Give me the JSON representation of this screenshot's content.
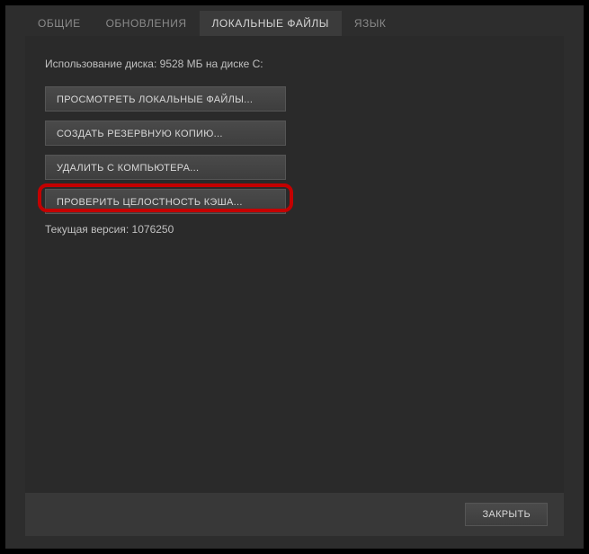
{
  "tabs": {
    "general": "ОБЩИЕ",
    "updates": "ОБНОВЛЕНИЯ",
    "local_files": "ЛОКАЛЬНЫЕ ФАЙЛЫ",
    "language": "ЯЗЫК"
  },
  "content": {
    "disk_usage": "Использование диска: 9528 МБ на диске C:",
    "browse_local": "ПРОСМОТРЕТЬ ЛОКАЛЬНЫЕ ФАЙЛЫ...",
    "backup": "СОЗДАТЬ РЕЗЕРВНУЮ КОПИЮ...",
    "delete": "УДАЛИТЬ С КОМПЬЮТЕРА...",
    "verify": "ПРОВЕРИТЬ ЦЕЛОСТНОСТЬ КЭША...",
    "version": "Текущая версия: 1076250"
  },
  "footer": {
    "close": "ЗАКРЫТЬ"
  }
}
